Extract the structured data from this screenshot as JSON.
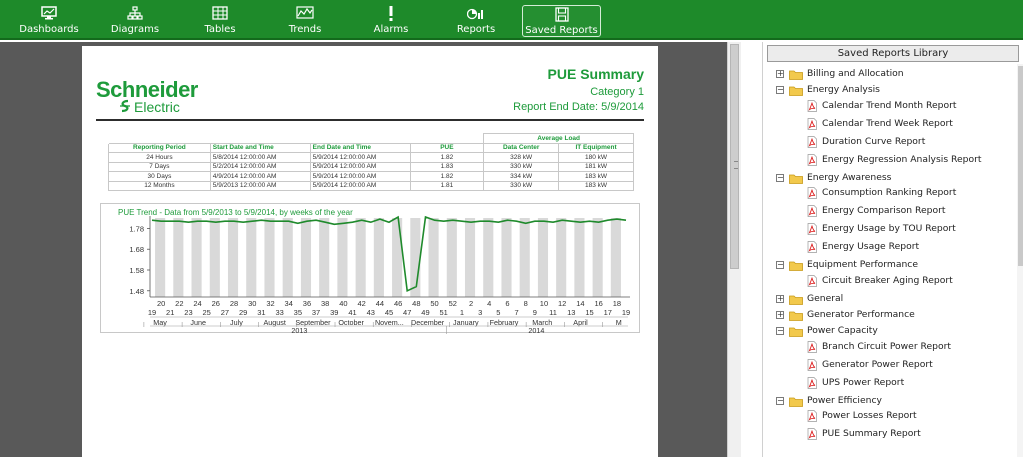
{
  "nav": {
    "items": [
      {
        "label": "Dashboards",
        "icon": "dashboard-icon"
      },
      {
        "label": "Diagrams",
        "icon": "diagram-icon"
      },
      {
        "label": "Tables",
        "icon": "table-icon"
      },
      {
        "label": "Trends",
        "icon": "trend-icon"
      },
      {
        "label": "Alarms",
        "icon": "alarm-icon"
      },
      {
        "label": "Reports",
        "icon": "reports-icon"
      },
      {
        "label": "Saved Reports",
        "icon": "saved-reports-icon",
        "active": true
      }
    ]
  },
  "report": {
    "logo_name": "Schneider",
    "logo_sub": "Electric",
    "title": "PUE Summary",
    "category": "Category 1",
    "end_date": "Report End Date: 5/9/2014",
    "table": {
      "group_header": "Average Load",
      "headers": [
        "Reporting Period",
        "Start Date and Time",
        "End Date and Time",
        "PUE",
        "Data Center",
        "IT Equipment"
      ],
      "rows": [
        [
          "24 Hours",
          "5/8/2014 12:00:00 AM",
          "5/9/2014 12:00:00 AM",
          "1.82",
          "328 kW",
          "180 kW"
        ],
        [
          "7 Days",
          "5/2/2014 12:00:00 AM",
          "5/9/2014 12:00:00 AM",
          "1.83",
          "330 kW",
          "181 kW"
        ],
        [
          "30 Days",
          "4/9/2014 12:00:00 AM",
          "5/9/2014 12:00:00 AM",
          "1.82",
          "334 kW",
          "183 kW"
        ],
        [
          "12 Months",
          "5/9/2013 12:00:00 AM",
          "5/9/2014 12:00:00 AM",
          "1.81",
          "330 kW",
          "183 kW"
        ]
      ]
    }
  },
  "chart_data": {
    "type": "line",
    "title": "PUE Trend - Data from 5/9/2013 to 5/9/2014, by weeks of the year",
    "x": [
      "19",
      "20",
      "21",
      "22",
      "23",
      "24",
      "25",
      "26",
      "27",
      "28",
      "29",
      "30",
      "31",
      "32",
      "33",
      "34",
      "35",
      "36",
      "37",
      "38",
      "39",
      "40",
      "41",
      "42",
      "43",
      "44",
      "45",
      "46",
      "47",
      "48",
      "49",
      "50",
      "51",
      "52",
      "1",
      "2",
      "3",
      "4",
      "5",
      "6",
      "7",
      "8",
      "9",
      "10",
      "11",
      "12",
      "13",
      "14",
      "15",
      "16",
      "17",
      "18",
      "19"
    ],
    "values": [
      1.82,
      1.815,
      1.815,
      1.815,
      1.81,
      1.815,
      1.815,
      1.81,
      1.815,
      1.815,
      1.81,
      1.815,
      1.82,
      1.815,
      1.815,
      1.815,
      1.805,
      1.815,
      1.82,
      1.81,
      1.8,
      1.805,
      1.81,
      1.82,
      1.81,
      1.825,
      1.81,
      1.835,
      1.48,
      1.5,
      1.835,
      1.82,
      1.815,
      1.82,
      1.815,
      1.81,
      1.815,
      1.815,
      1.81,
      1.82,
      1.815,
      1.805,
      1.815,
      1.815,
      1.81,
      1.82,
      1.815,
      1.81,
      1.815,
      1.81,
      1.82,
      1.825,
      1.82
    ],
    "yticks": [
      "1.78",
      "1.68",
      "1.58",
      "1.48"
    ],
    "ylim": [
      1.45,
      1.84
    ],
    "months": [
      "May",
      "June",
      "July",
      "August",
      "September",
      "October",
      "Novem...",
      "December",
      "January",
      "February",
      "March",
      "April",
      "M"
    ],
    "years": [
      "2013",
      "2014"
    ],
    "line_color": "#1f8a2c",
    "bar_color": "#d9d9d9",
    "grid": false
  },
  "library": {
    "title": "Saved Reports Library",
    "tree": [
      {
        "type": "folder",
        "label": "Billing and Allocation",
        "expanded": false
      },
      {
        "type": "folder",
        "label": "Energy Analysis",
        "expanded": true
      },
      {
        "type": "report",
        "label": "Calendar Trend Month Report"
      },
      {
        "type": "report",
        "label": "Calendar Trend Week Report"
      },
      {
        "type": "report",
        "label": "Duration Curve Report"
      },
      {
        "type": "report",
        "label": "Energy Regression Analysis Report"
      },
      {
        "type": "folder",
        "label": "Energy Awareness",
        "expanded": true
      },
      {
        "type": "report",
        "label": "Consumption Ranking Report"
      },
      {
        "type": "report",
        "label": "Energy Comparison Report"
      },
      {
        "type": "report",
        "label": "Energy Usage by TOU Report"
      },
      {
        "type": "report",
        "label": "Energy Usage Report"
      },
      {
        "type": "folder",
        "label": "Equipment Performance",
        "expanded": true
      },
      {
        "type": "report",
        "label": "Circuit Breaker Aging Report"
      },
      {
        "type": "folder",
        "label": "General",
        "expanded": false
      },
      {
        "type": "folder",
        "label": "Generator Performance",
        "expanded": false
      },
      {
        "type": "folder",
        "label": "Power Capacity",
        "expanded": true
      },
      {
        "type": "report",
        "label": "Branch Circuit Power Report"
      },
      {
        "type": "report",
        "label": "Generator Power Report"
      },
      {
        "type": "report",
        "label": "UPS Power Report"
      },
      {
        "type": "folder",
        "label": "Power Efficiency",
        "expanded": true
      },
      {
        "type": "report",
        "label": "Power Losses Report"
      },
      {
        "type": "report",
        "label": "PUE Summary Report"
      }
    ]
  }
}
